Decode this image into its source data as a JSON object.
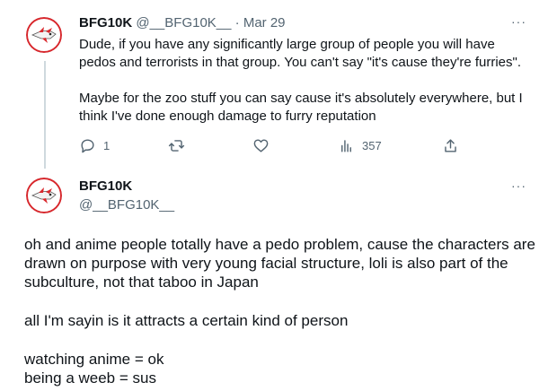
{
  "tweet1": {
    "display_name": "BFG10K",
    "handle": "@__BFG10K__",
    "separator": "·",
    "date": "Mar 29",
    "more": "···",
    "paragraph1": "Dude, if you have any significantly large group of people you will have pedos and terrorists in that group. You can't say \"it's cause they're furries\".",
    "paragraph2": "Maybe for the zoo stuff you can say cause it's absolutely everywhere, but I think I've done enough damage to furry reputation",
    "actions": {
      "reply_icon": "reply-icon",
      "reply_count": "1",
      "retweet_icon": "retweet-icon",
      "like_icon": "heart-icon",
      "views_icon": "views-icon",
      "views_count": "357",
      "share_icon": "share-icon"
    }
  },
  "tweet2": {
    "display_name": "BFG10K",
    "handle": "@__BFG10K__",
    "more": "···",
    "line1": "oh and anime people totally have a pedo problem, cause the characters are drawn on purpose with very young facial structure, loli is also part of the subculture, not that taboo in Japan",
    "line2": "all I'm sayin is it attracts a certain kind of person",
    "line3": "watching anime = ok",
    "line4": "being a weeb = sus"
  },
  "colors": {
    "text": "#0f1419",
    "muted": "#536471",
    "thread_line": "#cfd9de",
    "avatar_red": "#d9262b"
  }
}
